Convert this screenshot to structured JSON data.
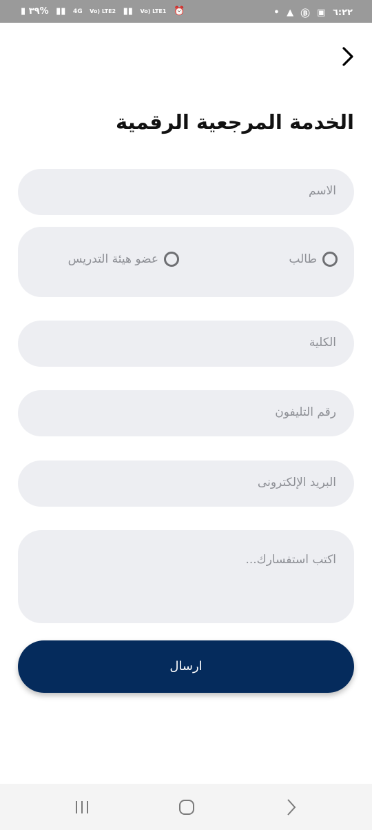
{
  "status_bar": {
    "time": "٦:٢٢",
    "battery": "٣٩%",
    "network_1": "4G",
    "network_2": "Vo) LTE2",
    "network_3": "Vo) LTE1"
  },
  "header": {
    "title": "الخدمة المرجعية الرقمية"
  },
  "form": {
    "name_placeholder": "الاسم",
    "role_options": [
      {
        "label": "طالب",
        "selected": false
      },
      {
        "label": "عضو هيئة التدريس",
        "selected": false
      }
    ],
    "faculty_placeholder": "الكلية",
    "phone_placeholder": "رقم التليفون",
    "email_placeholder": "البريد الإلكترونى",
    "inquiry_placeholder": "اكتب استفسارك...",
    "submit_label": "ارسال"
  },
  "colors": {
    "primary": "#052b5c",
    "field_bg": "#edeef2",
    "placeholder": "#8d8f95"
  }
}
